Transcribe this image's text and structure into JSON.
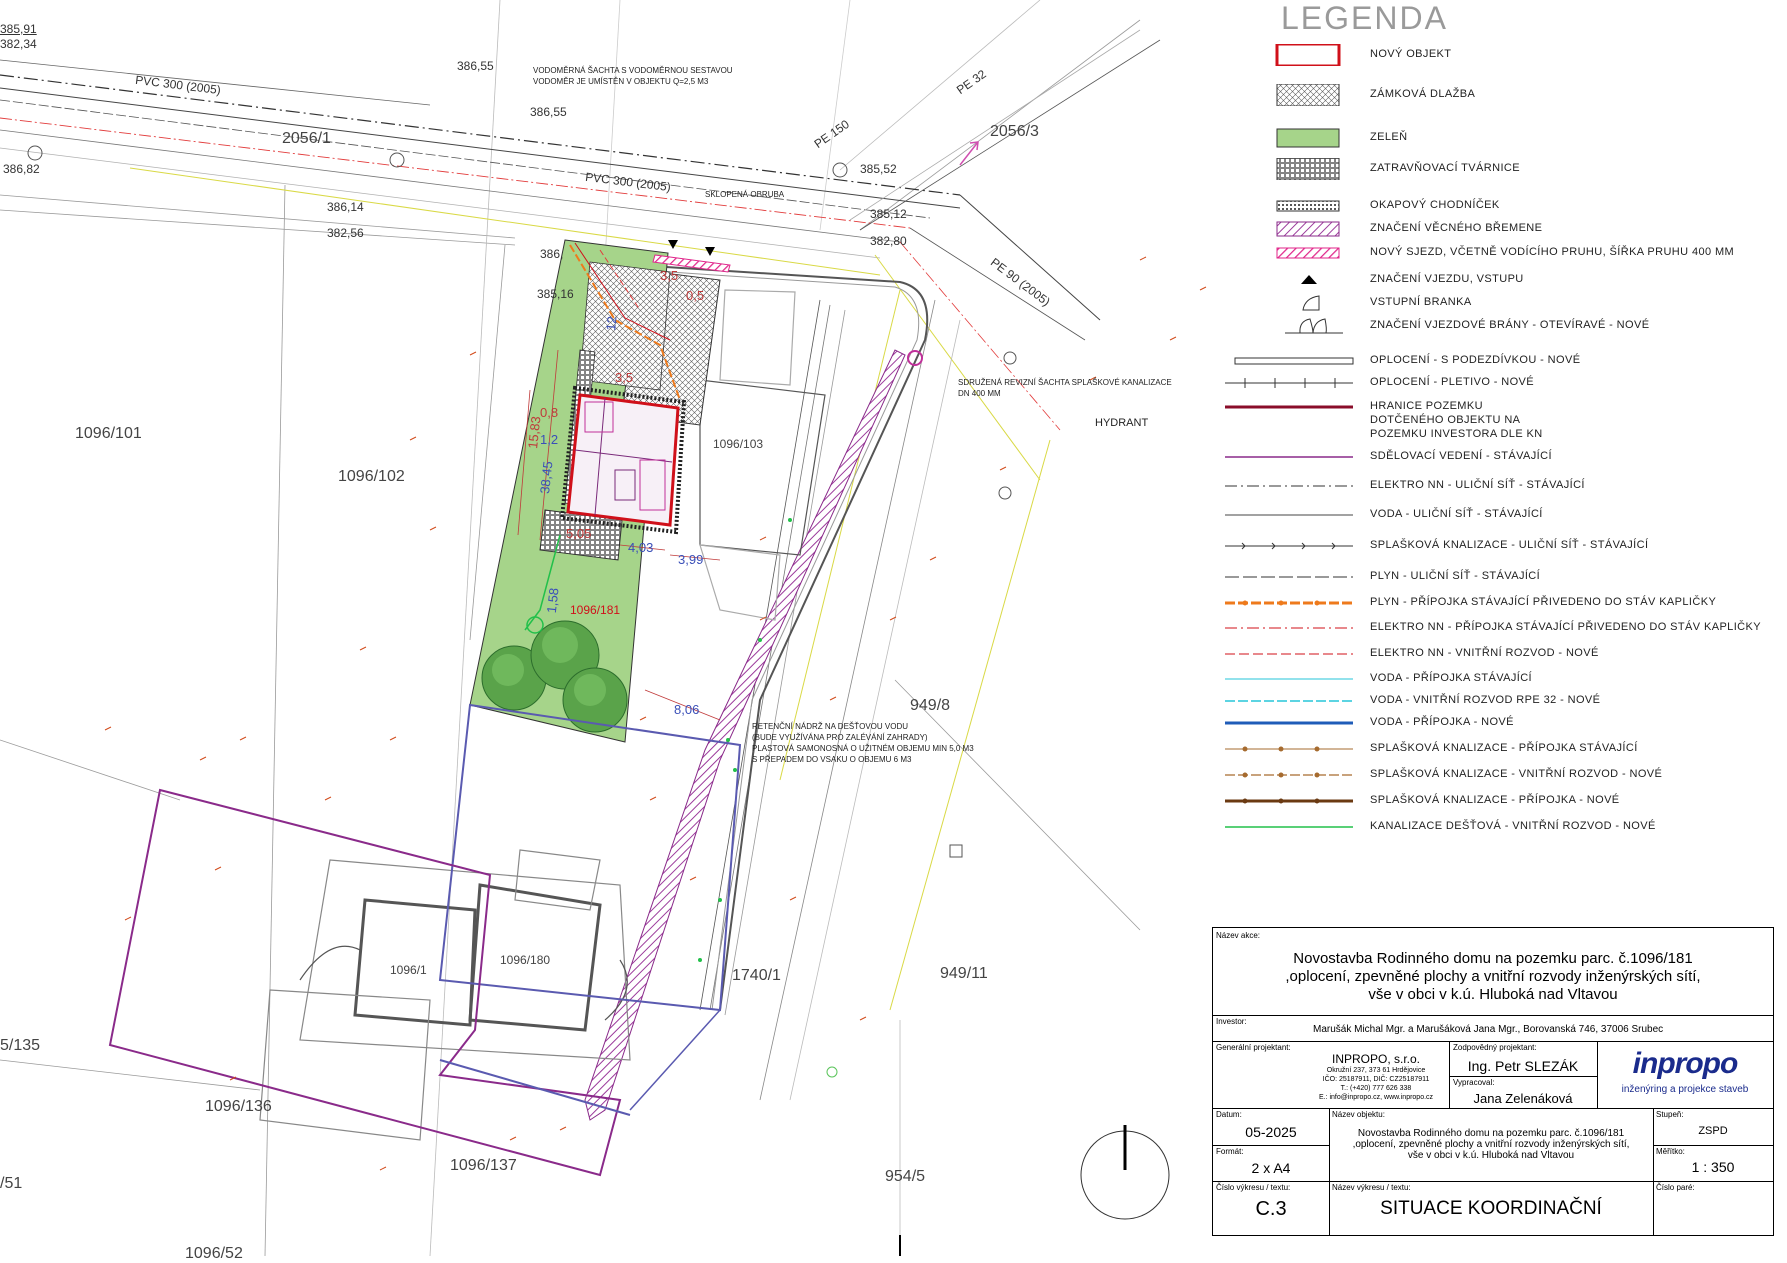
{
  "legend": {
    "title": "LEGENDA",
    "items": [
      {
        "label": "NOVÝ OBJEKT",
        "sym": "new-object"
      },
      {
        "label": "ZÁMKOVÁ DLAŽBA",
        "sym": "paving"
      },
      {
        "label": "ZELEŇ",
        "sym": "green"
      },
      {
        "label": "ZATRAVŇOVACÍ TVÁRNICE",
        "sym": "grass-blocks"
      },
      {
        "label": "OKAPOVÝ CHODNÍČEK",
        "sym": "drip-path"
      },
      {
        "label": "ZNAČENÍ VĚCNÉHO BŘEMENE",
        "sym": "easement"
      },
      {
        "label": "NOVÝ SJEZD, VČETNĚ VODÍCÍHO PRUHU, ŠÍŘKA PRUHU 400 MM",
        "sym": "new-driveway"
      },
      {
        "label": "ZNAČENÍ VJEZDU, VSTUPU",
        "sym": "entry-mark"
      },
      {
        "label": "VSTUPNÍ BRANKA",
        "sym": "gate"
      },
      {
        "label": "ZNAČENÍ VJEZDOVÉ BRÁNY - OTEVÍRAVÉ - NOVÉ",
        "sym": "entry-gate"
      },
      {
        "label": "OPLOCENÍ - S PODEZDÍVKOU - NOVÉ",
        "sym": "fence-wall"
      },
      {
        "label": "OPLOCENÍ - PLETIVO - NOVÉ",
        "sym": "fence-mesh"
      },
      {
        "label": "HRANICE POZEMKU",
        "sym": "boundary"
      },
      {
        "label": "DOTČENÉHO OBJEKTU NA",
        "sym": "none"
      },
      {
        "label": "POZEMKU INVESTORA DLE KN",
        "sym": "none"
      },
      {
        "label": "SDĚLOVACÍ VEDENÍ - STÁVAJÍCÍ",
        "sym": "telecom"
      },
      {
        "label": "ELEKTRO NN - ULIČNÍ SÍŤ - STÁVAJÍCÍ",
        "sym": "elec-street"
      },
      {
        "label": "VODA - ULIČNÍ SÍŤ - STÁVAJÍCÍ",
        "sym": "water-street"
      },
      {
        "label": "SPLAŠKOVÁ KNALIZACE - ULIČNÍ SÍŤ - STÁVAJÍCÍ",
        "sym": "sewer-street"
      },
      {
        "label": "PLYN - ULIČNÍ SÍŤ - STÁVAJÍCÍ",
        "sym": "gas-street"
      },
      {
        "label": "PLYN - PŘÍPOJKA STÁVAJÍCÍ PŘIVEDENO DO STÁV KAPLIČKY",
        "sym": "gas-conn"
      },
      {
        "label": "ELEKTRO NN - PŘÍPOJKA STÁVAJÍCÍ PŘIVEDENO DO STÁV KAPLIČKY",
        "sym": "elec-conn"
      },
      {
        "label": "ELEKTRO NN - VNITŘNÍ ROZVOD - NOVÉ",
        "sym": "elec-int"
      },
      {
        "label": "VODA - PŘÍPOJKA STÁVAJÍCÍ",
        "sym": "water-conn"
      },
      {
        "label": "VODA - VNITŘNÍ ROZVOD RPE 32 - NOVÉ",
        "sym": "water-int"
      },
      {
        "label": "VODA - PŘÍPOJKA - NOVÉ",
        "sym": "water-new"
      },
      {
        "label": "SPLAŠKOVÁ KNALIZACE - PŘÍPOJKA STÁVAJÍCÍ",
        "sym": "sewer-conn"
      },
      {
        "label": "SPLAŠKOVÁ KNALIZACE - VNITŘNÍ ROZVOD - NOVÉ",
        "sym": "sewer-int"
      },
      {
        "label": "SPLAŠKOVÁ KNALIZACE - PŘÍPOJKA - NOVÉ",
        "sym": "sewer-new"
      },
      {
        "label": "KANALIZACE DEŠŤOVÁ - VNITŘNÍ ROZVOD - NOVÉ",
        "sym": "rain-int"
      }
    ]
  },
  "plan": {
    "parcels": [
      {
        "text": "1096/101",
        "cls": ""
      },
      {
        "text": "1096/102",
        "cls": ""
      },
      {
        "text": "1096/103",
        "cls": "small"
      },
      {
        "text": "1096/181",
        "cls": "red"
      },
      {
        "text": "2056/1",
        "cls": ""
      },
      {
        "text": "2056/3",
        "cls": ""
      },
      {
        "text": "949/8",
        "cls": ""
      },
      {
        "text": "1740/1",
        "cls": ""
      },
      {
        "text": "949/11",
        "cls": ""
      },
      {
        "text": "1096/1",
        "cls": "small"
      },
      {
        "text": "1096/180",
        "cls": "small"
      },
      {
        "text": "1096/136",
        "cls": ""
      },
      {
        "text": "1096/137",
        "cls": ""
      },
      {
        "text": "954/5",
        "cls": ""
      },
      {
        "text": "5/135",
        "cls": ""
      },
      {
        "text": "/51",
        "cls": ""
      },
      {
        "text": "1096/52",
        "cls": ""
      }
    ],
    "levels": [
      {
        "text": "385,91"
      },
      {
        "text": "382,34"
      },
      {
        "text": "386,55"
      },
      {
        "text": "386,55"
      },
      {
        "text": "386,82"
      },
      {
        "text": "386,14"
      },
      {
        "text": "382,56"
      },
      {
        "text": "385,52"
      },
      {
        "text": "385,12"
      },
      {
        "text": "382,80"
      },
      {
        "text": "385,16"
      },
      {
        "text": "386,"
      }
    ],
    "pipes": [
      {
        "text": "PVC 300 (2005)"
      },
      {
        "text": "PVC 300 (2005)"
      },
      {
        "text": "PE 32"
      },
      {
        "text": "PE 150"
      },
      {
        "text": "PE 90 (2005)"
      }
    ],
    "dims": [
      {
        "text": "15,83"
      },
      {
        "text": "38,45"
      },
      {
        "text": "4,03"
      },
      {
        "text": "3,99"
      },
      {
        "text": "1,58"
      },
      {
        "text": "8,06"
      },
      {
        "text": "5,05"
      },
      {
        "text": "1,2"
      },
      {
        "text": "0,8"
      },
      {
        "text": "3,5"
      },
      {
        "text": "12"
      },
      {
        "text": "3,5"
      },
      {
        "text": "0,5"
      }
    ],
    "notes": {
      "water_shaft_1": "VODOMĚRNÁ ŠACHTA S VODOMĚRNOU SESTAVOU",
      "water_shaft_2": "VODOMĚR JE UMÍSTĚN V OBJEKTU Q=2,5 M3",
      "slope": "SKLOPENÁ OBRUBA",
      "sewer_shaft_1": "SDRUŽENÁ REVIZNÍ ŠACHTA SPLAŠKOVÉ KANALIZACE",
      "sewer_shaft_2": "DN 400 MM",
      "hydrant": "HYDRANT",
      "tank_1": "RETENČNÍ NÁDRŽ NA DEŠŤOVOU VODU",
      "tank_2": "(BUDE VYUŽÍVÁNA PRO ZALÉVÁNÍ ZAHRADY)",
      "tank_3": "PLASTOVÁ SAMONOSNÁ O UŽITNÉM OBJEMU MIN 5,0 M3",
      "tank_4": "S PŘEPADEM DO VSAKU O OBJEMU 6 M3"
    }
  },
  "titleblock": {
    "project_cap": "Název akce:",
    "project_l1": "Novostavba Rodinného domu na pozemku parc. č.1096/181",
    "project_l2": ",oplocení, zpevněné plochy a vnitřní rozvody inženýrských sítí,",
    "project_l3": "vše v obci v k.ú. Hluboká nad Vltavou",
    "investor_cap": "Investor:",
    "investor": "Marušák Michal Mgr. a Marušáková Jana Mgr., Borovanská 746, 37006 Srubec",
    "gp_cap": "Generální projektant:",
    "gp_name": "INPROPO, s.r.o.",
    "gp_l1": "Okružní 237, 373 61 Hrdějovice",
    "gp_l2": "IČO: 25187911, DIČ: CZ25187911",
    "gp_l3": "T.: (+420) 777 626 338",
    "gp_l4": "E.: info@inpropo.cz, www.inpropo.cz",
    "resp_cap": "Zodpovědný projektant:",
    "resp": "Ing. Petr SLEZÁK",
    "drawn_cap": "Vypracoval:",
    "drawn": "Jana Zelenáková",
    "logo": "inpropo",
    "logo_sub": "inženýring a projekce staveb",
    "date_cap": "Datum:",
    "date": "05-2025",
    "format_cap": "Formát:",
    "format": "2 x A4",
    "obj_cap": "Název objektu:",
    "obj_l1": "Novostavba Rodinného domu na pozemku parc. č.1096/181",
    "obj_l2": ",oplocení, zpevněné plochy a vnitřní rozvody inženýrských sítí,",
    "obj_l3": "vše v obci v k.ú. Hluboká nad Vltavou",
    "stage_cap": "Stupeň:",
    "stage": "ZSPD",
    "scale_cap": "Měřítko:",
    "scale": "1 : 350",
    "drawno_cap": "Číslo výkresu / textu:",
    "drawno": "C.3",
    "dname_cap": "Název výkresu / textu:",
    "dname": "SITUACE KOORDINAČNÍ",
    "copy_cap": "Číslo paré:"
  }
}
